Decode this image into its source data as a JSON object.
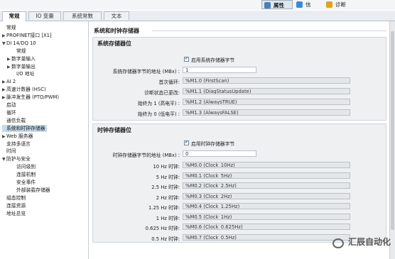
{
  "top_tabs": [
    {
      "label": "属性",
      "active": true
    },
    {
      "label": "信息",
      "active": false
    },
    {
      "label": "诊断",
      "active": false
    }
  ],
  "tabs": [
    {
      "label": "常规",
      "active": true
    },
    {
      "label": "IO 变量",
      "active": false
    },
    {
      "label": "系统常数",
      "active": false
    },
    {
      "label": "文本",
      "active": false
    }
  ],
  "sidebar": {
    "items": [
      {
        "label": "常规",
        "indent": 0,
        "arrow": ""
      },
      {
        "label": "PROFINET接口 [X1]",
        "indent": 0,
        "arrow": "▶"
      },
      {
        "label": "DI 14/DQ 10",
        "indent": 0,
        "arrow": "▼"
      },
      {
        "label": "常规",
        "indent": 2,
        "arrow": ""
      },
      {
        "label": "数字量输入",
        "indent": 1,
        "arrow": "▶"
      },
      {
        "label": "数字量输出",
        "indent": 1,
        "arrow": "▶"
      },
      {
        "label": "I/O 地址",
        "indent": 2,
        "arrow": ""
      },
      {
        "label": "AI 2",
        "indent": 0,
        "arrow": "▶"
      },
      {
        "label": "高速计数器 (HSC)",
        "indent": 0,
        "arrow": "▶"
      },
      {
        "label": "脉冲发生器 (PTO/PWM)",
        "indent": 0,
        "arrow": "▶"
      },
      {
        "label": "启动",
        "indent": 0,
        "arrow": ""
      },
      {
        "label": "循环",
        "indent": 0,
        "arrow": ""
      },
      {
        "label": "通信负载",
        "indent": 0,
        "arrow": ""
      },
      {
        "label": "系统和时钟存储器",
        "indent": 0,
        "arrow": "",
        "selected": true
      },
      {
        "label": "Web 服务器",
        "indent": 0,
        "arrow": "▶"
      },
      {
        "label": "支持多语言",
        "indent": 0,
        "arrow": ""
      },
      {
        "label": "时间",
        "indent": 0,
        "arrow": ""
      },
      {
        "label": "防护与安全",
        "indent": 0,
        "arrow": "▼"
      },
      {
        "label": "访问级别",
        "indent": 2,
        "arrow": ""
      },
      {
        "label": "连接机制",
        "indent": 2,
        "arrow": ""
      },
      {
        "label": "安全事件",
        "indent": 2,
        "arrow": ""
      },
      {
        "label": "外部装载存储器",
        "indent": 2,
        "arrow": ""
      },
      {
        "label": "组态控制",
        "indent": 0,
        "arrow": ""
      },
      {
        "label": "连接资源",
        "indent": 0,
        "arrow": ""
      },
      {
        "label": "地址总览",
        "indent": 0,
        "arrow": ""
      }
    ]
  },
  "main": {
    "title": "系统和时钟存储器",
    "system_memory": {
      "title": "系统存储器位",
      "enable_label": "启用系统存储器字节",
      "address_label": "系统存储器字节的地址 (MBx) :",
      "address_value": "1",
      "rows": [
        {
          "label": "首次循环:",
          "value": "%M1.0 (FirstScan)"
        },
        {
          "label": "诊断状态已更改:",
          "value": "%M1.1 (DiagStatusUpdate)"
        },
        {
          "label": "始终为 1 (高电平) :",
          "value": "%M1.2 (AlwaysTRUE)"
        },
        {
          "label": "始终为 0 (低电平) :",
          "value": "%M1.3 (AlwaysFALSE)"
        }
      ]
    },
    "clock_memory": {
      "title": "时钟存储器位",
      "enable_label": "启用时钟存储器字节",
      "address_label": "时钟存储器字节的地址 (MBx) :",
      "address_value": "0",
      "rows": [
        {
          "label": "10 Hz 时钟:",
          "value": "%M0.0 (Clock_10Hz)"
        },
        {
          "label": "5 Hz 时钟:",
          "value": "%M0.1 (Clock_5Hz)"
        },
        {
          "label": "2.5 Hz 时钟:",
          "value": "%M0.2 (Clock_2.5Hz)"
        },
        {
          "label": "2 Hz 时钟:",
          "value": "%M0.3 (Clock_2Hz)"
        },
        {
          "label": "1.25 Hz 时钟:",
          "value": "%M0.4 (Clock_1.25Hz)"
        },
        {
          "label": "1 Hz 时钟:",
          "value": "%M0.5 (Clock_1Hz)"
        },
        {
          "label": "0.625 Hz 时钟:",
          "value": "%M0.6 (Clock_0.625Hz)"
        },
        {
          "label": "0.5 Hz 时钟:",
          "value": "%M0.7 (Clock_0.5Hz)"
        }
      ]
    }
  },
  "watermark": "汇辰自动化",
  "colors": {
    "selected": "#c5dbf0",
    "panel": "#eef0f2",
    "accent": "#1b6bb8"
  }
}
